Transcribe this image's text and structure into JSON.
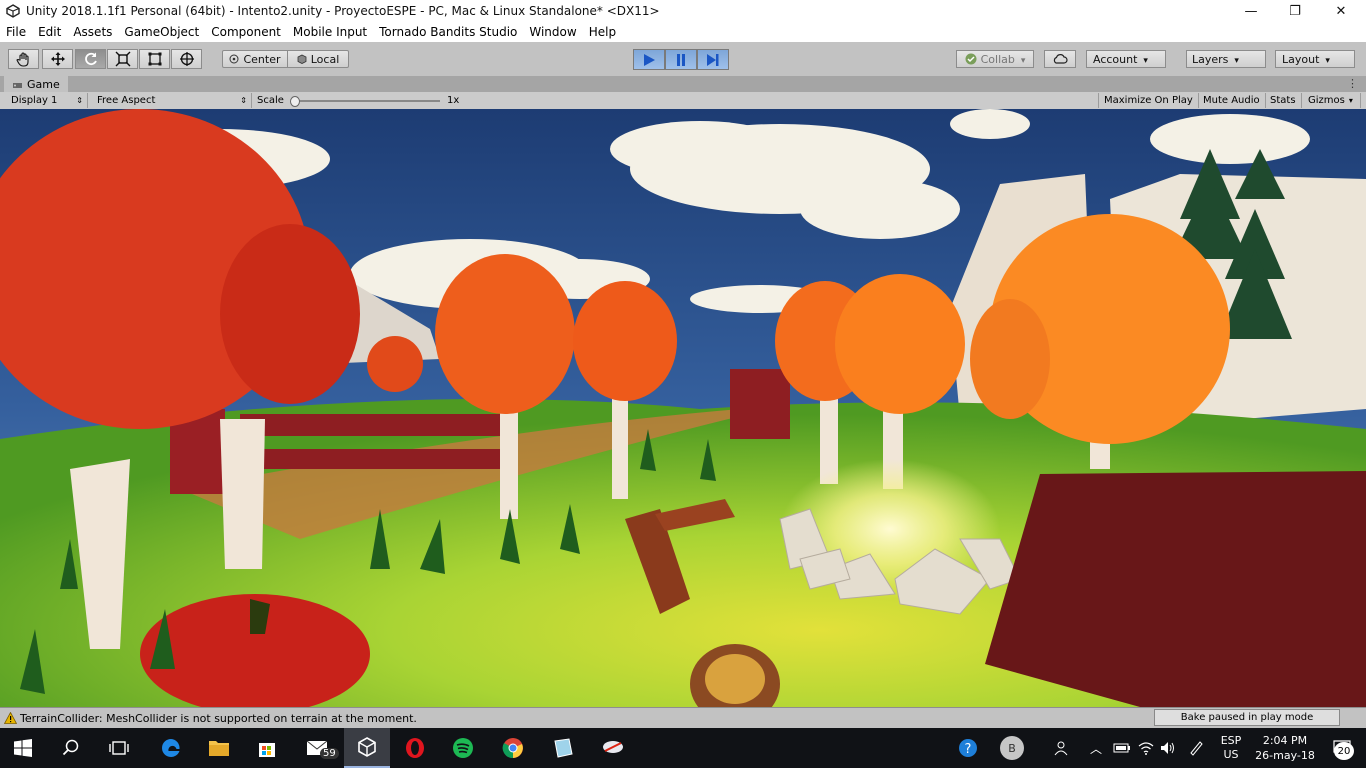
{
  "window": {
    "title": "Unity 2018.1.1f1 Personal (64bit) - Intento2.unity - ProyectoESPE - PC, Mac & Linux Standalone* <DX11>",
    "minimize_glyph": "—",
    "maximize_glyph": "❐",
    "close_glyph": "✕"
  },
  "menu": [
    "File",
    "Edit",
    "Assets",
    "GameObject",
    "Component",
    "Mobile Input",
    "Tornado Bandits Studio",
    "Window",
    "Help"
  ],
  "toolbar": {
    "tools": [
      "hand-tool-icon",
      "move-tool-icon",
      "rotate-tool-icon",
      "scale-tool-icon",
      "rect-tool-icon",
      "transform-tool-icon"
    ],
    "pivot_label": "Center",
    "space_label": "Local",
    "collab_label": "Collab",
    "account_label": "Account",
    "layers_label": "Layers",
    "layout_label": "Layout"
  },
  "game_tab": {
    "label": "Game",
    "display": "Display 1",
    "aspect": "Free Aspect",
    "scale_label": "Scale",
    "scale_value": "1x",
    "scale_level": 0.0,
    "toggles": [
      "Maximize On Play",
      "Mute Audio",
      "Stats",
      "Gizmos"
    ]
  },
  "status": {
    "message": "TerrainCollider: MeshCollider is not supported on terrain at the moment.",
    "bake": "Bake paused in play mode"
  },
  "taskbar": {
    "mail_badge": "59",
    "notification_badge": "20",
    "lang_top": "ESP",
    "lang_bottom": "US",
    "time": "2:04 PM",
    "date": "26-may-18",
    "avatar_letter": "B"
  },
  "colors": {
    "play_active": "#7ea6d8",
    "panel_gray": "#c2c2c2",
    "taskbar": "#101216"
  }
}
